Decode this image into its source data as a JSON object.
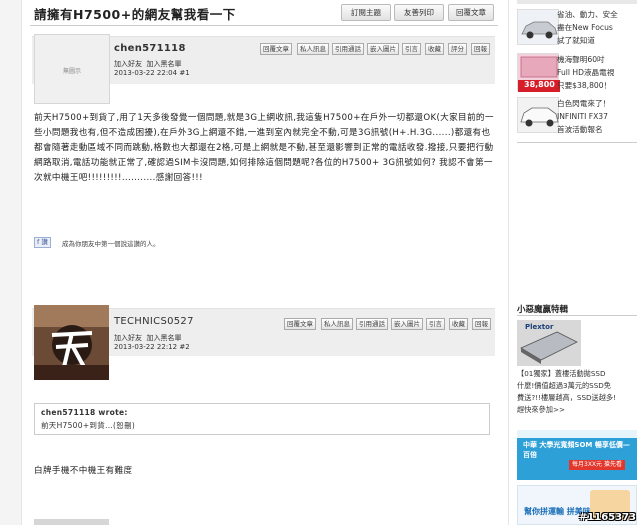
{
  "thread": {
    "title": "請擁有H7500+的網友幫我看一下",
    "buttons": [
      "訂閱主題",
      "友善列印",
      "回覆文章"
    ]
  },
  "toolbar_labels": [
    "回覆文章",
    "私人訊息",
    "引用通話",
    "嵌入圖片",
    "引言",
    "收藏",
    "評分",
    "回報"
  ],
  "toolbar_labels_2": [
    "回覆文章",
    "私人訊息",
    "引用通話",
    "嵌入圖片",
    "引言",
    "收藏",
    "回報"
  ],
  "post1": {
    "avatar_placeholder": "無圖示",
    "username": "chen571118",
    "add_friend": "加入好友",
    "add_blacklist": "加入黑名單",
    "datetime": "2013-03-22 22:04",
    "floor": "#1",
    "body": "前天H7500+到貨了,用了1天多後發覺一個問題,就是3G上網收訊,我這隻H7500+在戶外一切都還OK(大家目前的一些小問題我也有,但不造成困擾),在戶外3G上網還不錯,一進到室內就完全不動,可是3G訊號(H+.H.3G......)都還有也都會隨著走動區域不同而跳動,格數也大都還在2格,可是上網就是不動,甚至還影響到正常的電話收發.撥接,只要把行動網路取消,電話功能就正常了,確認過SIM卡沒問題,如何排除這個問題呢?各位的H7500+ 3G訊號如何? 我認不會第一次就中機王吧!!!!!!!!!...........感謝回答!!!",
    "fb_like": "讚",
    "fb_text": "成為你朋友中第一個說這讚的人。"
  },
  "post2": {
    "username": "TECHNICS0527",
    "add_friend": "加入好友",
    "add_blacklist": "加入黑名單",
    "datetime": "2013-03-22 22:12",
    "floor": "#2",
    "quote_author": "chen571118 wrote:",
    "quote_text": "前天H7500+到貨...(恕刪)",
    "body": "白牌手機不中機王有難度"
  },
  "sidebar": {
    "ad1_text": "省油、動力、安全\n盡在New Focus\n試了就知道",
    "ad2_price": "38,800",
    "ad2_text": "機海聲明60吋\nFull HD液晶電視\n只要$38,800！",
    "ad3_text": "白色閃電來了！\nINFINITI FX37\n首波活動報名",
    "section_title": "小惡魔贏特輯",
    "ssd_brand": "Plextor",
    "promo_text": "【01獨家】蓋樓活動拋SSD\n什麼!價值超過3萬元的SSD免\n費送?!!樓層越高，SSD送越多!\n趕快來參加>>",
    "banner1_text": "中華 大學光寬頻SOM 暢享低價—百倍",
    "banner1_sub": "每月3XX元 搶先看",
    "banner2_text": "幫你拼運輸 拼美味"
  },
  "watermark": "#1165373"
}
